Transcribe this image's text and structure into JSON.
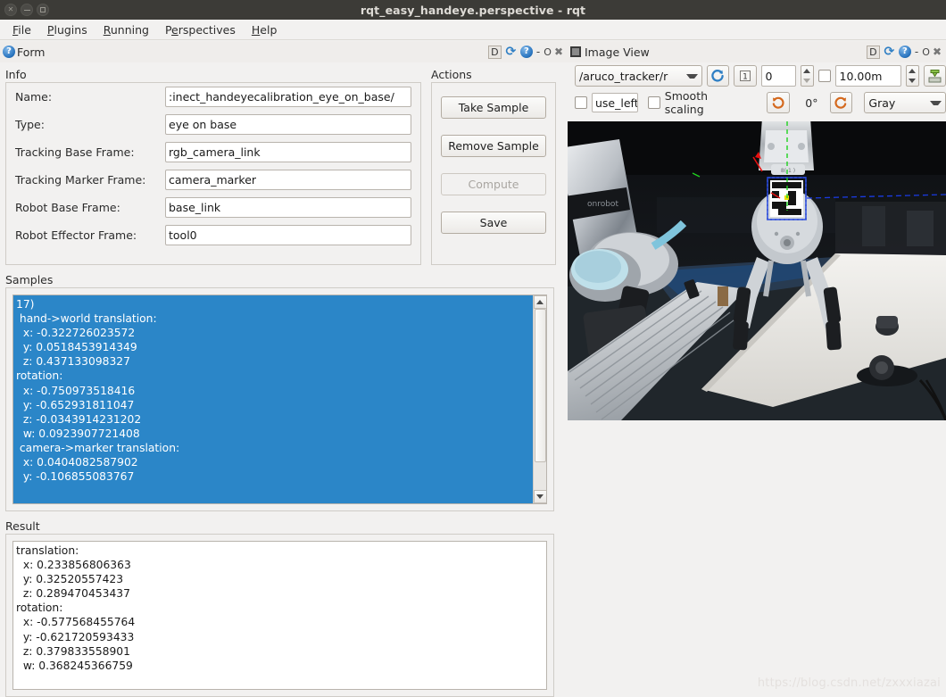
{
  "window": {
    "title": "rqt_easy_handeye.perspective - rqt",
    "buttons": {
      "close": "×",
      "minimize": "–",
      "maximize": "□"
    }
  },
  "menubar": {
    "items": [
      {
        "label": "File",
        "accel": "F"
      },
      {
        "label": "Plugins",
        "accel": "P"
      },
      {
        "label": "Running",
        "accel": "R"
      },
      {
        "label": "Perspectives",
        "accel": "e"
      },
      {
        "label": "Help",
        "accel": "H"
      }
    ]
  },
  "docks": {
    "left": {
      "title": "Form",
      "icon": "question-mark-icon",
      "controls": {
        "dock": "D",
        "reload": "⟳",
        "help": "?",
        "dash": "-",
        "o": "O",
        "close": "✖"
      }
    },
    "right": {
      "title": "Image View",
      "icon": "square-icon",
      "controls": {
        "dock": "D",
        "reload": "⟳",
        "help": "?",
        "dash": "-",
        "o": "O",
        "close": "✖"
      }
    }
  },
  "info": {
    "group_label": "Info",
    "fields": [
      {
        "label": "Name:",
        "value": ":inect_handeyecalibration_eye_on_base/"
      },
      {
        "label": "Type:",
        "value": "eye on base"
      },
      {
        "label": "Tracking Base Frame:",
        "value": "rgb_camera_link"
      },
      {
        "label": "Tracking Marker Frame:",
        "value": "camera_marker"
      },
      {
        "label": "Robot Base Frame:",
        "value": "base_link"
      },
      {
        "label": "Robot Effector Frame:",
        "value": "tool0"
      }
    ]
  },
  "actions": {
    "group_label": "Actions",
    "buttons": [
      {
        "label": "Take Sample",
        "enabled": true
      },
      {
        "label": "Remove Sample",
        "enabled": true
      },
      {
        "label": "Compute",
        "enabled": false
      },
      {
        "label": "Save",
        "enabled": true
      }
    ]
  },
  "samples": {
    "group_label": "Samples",
    "selected": true,
    "text": "17)\n hand->world translation:\n  x: -0.322726023572\n  y: 0.0518453914349\n  z: 0.437133098327\nrotation:\n  x: -0.750973518416\n  y: -0.652931811047\n  z: -0.0343914231202\n  w: 0.0923907721408\n camera->marker translation:\n  x: 0.0404082587902\n  y: -0.106855083767",
    "scroll_position": "near-bottom"
  },
  "result": {
    "group_label": "Result",
    "text": "translation:\n  x: 0.233856806363\n  y: 0.32520557423\n  z: 0.289470453437\nrotation:\n  x: -0.577568455764\n  y: -0.621720593433\n  z: 0.379833558901\n  w: 0.368245366759"
  },
  "image_view": {
    "topic": "/aruco_tracker/r",
    "refresh_icon": "refresh-icon",
    "numbered_icon": "one-icon",
    "index_value": "0",
    "max_range_checkbox": false,
    "max_range_value": "10.00m",
    "save_icon": "save-image-icon",
    "mouse_checkbox": false,
    "mouse_label": "use_left",
    "smooth_scaling_checkbox": false,
    "smooth_scaling_label": "Smooth scaling",
    "rotate_left_icon": "rotate-left-icon",
    "rotation_value": "0°",
    "rotate_right_icon": "rotate-right-icon",
    "colormap": "Gray"
  },
  "watermark": "https://blog.csdn.net/zxxxiazai",
  "colors": {
    "selection_blue": "#2b86c8",
    "titlebar": "#3c3b37",
    "panel": "#f2f1f0",
    "accent_orange": "#d4691e",
    "icon_blue": "#2f7fc4"
  }
}
